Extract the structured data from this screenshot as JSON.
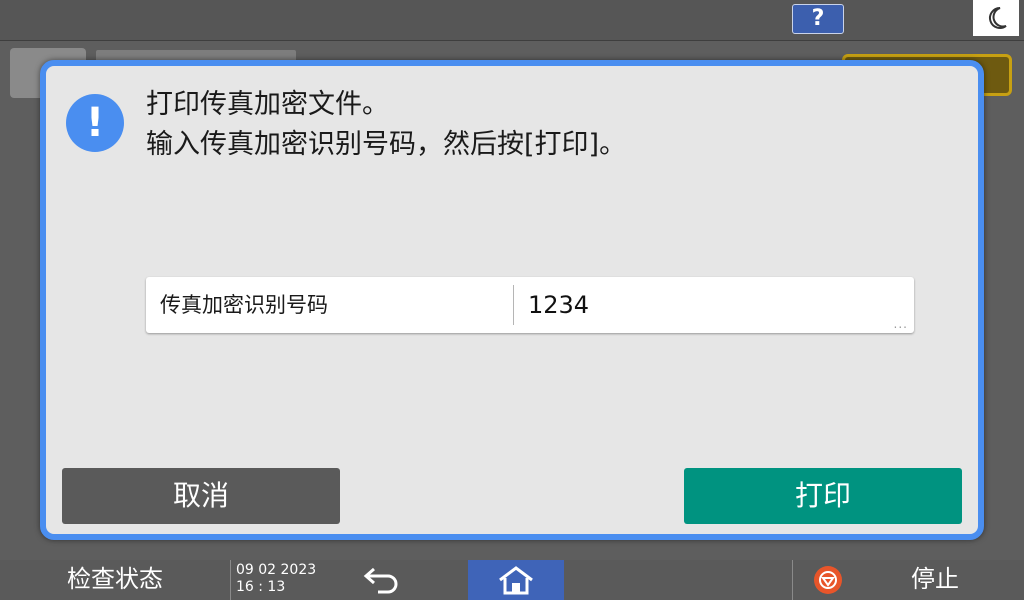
{
  "topbar": {
    "help_label": "?",
    "energy_icon": "moon-icon"
  },
  "dialog": {
    "icon": "exclamation-icon",
    "message_line1": "打印传真加密文件。",
    "message_line2": "输入传真加密识别号码，然后按[打印]。",
    "field": {
      "label": "传真加密识别号码",
      "value": "1234",
      "more_indicator": "..."
    },
    "cancel_label": "取消",
    "print_label": "打印"
  },
  "bottombar": {
    "status_label": "检查状态",
    "date": "09 02 2023",
    "time": "16 : 13",
    "back_icon": "back-arrow-icon",
    "home_icon": "home-icon",
    "stop_icon": "stop-icon",
    "stop_label": "停止"
  },
  "colors": {
    "dialog_border": "#4a8ef0",
    "print_button": "#009380",
    "cancel_button": "#5a5a5a",
    "home_button": "#3f64b8",
    "stop_icon": "#e8552a"
  }
}
